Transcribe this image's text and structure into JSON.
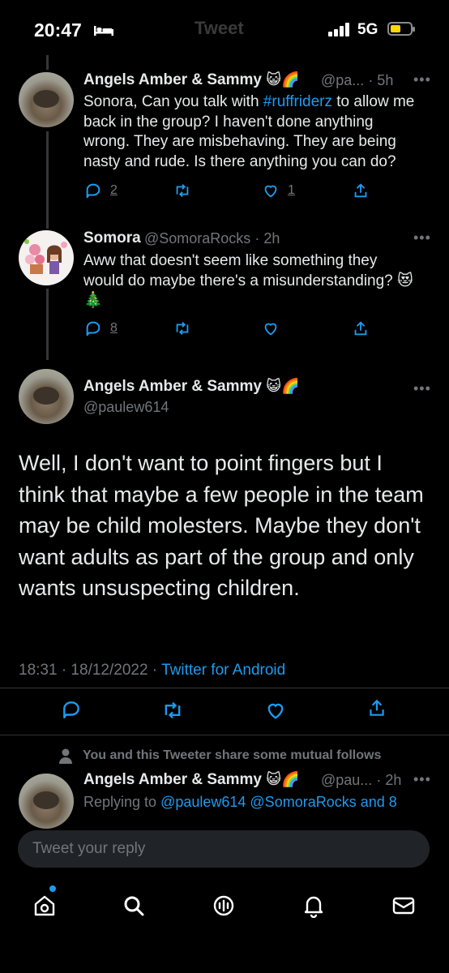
{
  "status_bar": {
    "time": "20:47",
    "ghost_title": "Tweet",
    "network": "5G",
    "battery_level": 0.35
  },
  "tweets": [
    {
      "name": "Angels Amber & Sammy",
      "emojis": "😺🌈",
      "handle": "@pa...",
      "time": "· 5h",
      "text_before": "Sonora, Can you talk with ",
      "hashtag": "#ruffriderz",
      "text_after": " to allow me back in the group? I haven't done anything wrong. They are misbehaving. They are being nasty and rude. Is there anything you can do?",
      "replies": "2",
      "retweets": "",
      "likes": "1"
    },
    {
      "name": "Somora",
      "handle": "@SomoraRocks",
      "time": "· 2h",
      "text": "Aww that doesn't seem like something they would do maybe there's a misunderstanding? 😻🎄",
      "replies": "8",
      "retweets": "",
      "likes": ""
    }
  ],
  "main_tweet": {
    "name": "Angels Amber & Sammy",
    "emojis": "😺🌈",
    "handle": "@paulew614",
    "text": "Well, I don't want to point fingers but I think that maybe a few people in the team may be child molesters. Maybe they don't want adults as part of the group and only wants unsuspecting children.",
    "timestamp": "18:31 · 18/12/2022 · ",
    "source": "Twitter for Android"
  },
  "mutual_notice": "You and this Tweeter share some mutual follows",
  "reply_preview": {
    "name": "Angels Amber & Sammy",
    "emojis": "😺🌈",
    "handle": "@pau...",
    "time": "· 2h",
    "replying_prefix": "Replying to ",
    "mentions": "@paulew614 @SomoraRocks and 8"
  },
  "reply_bar": {
    "placeholder": "Tweet your reply"
  },
  "bottom_nav": [
    "home-icon",
    "search-icon",
    "spaces-icon",
    "notifications-icon",
    "messages-icon"
  ],
  "colors": {
    "background": "#000000",
    "text": "#e7e9ea",
    "secondary": "#71767b",
    "accent": "#1d9bf0"
  }
}
